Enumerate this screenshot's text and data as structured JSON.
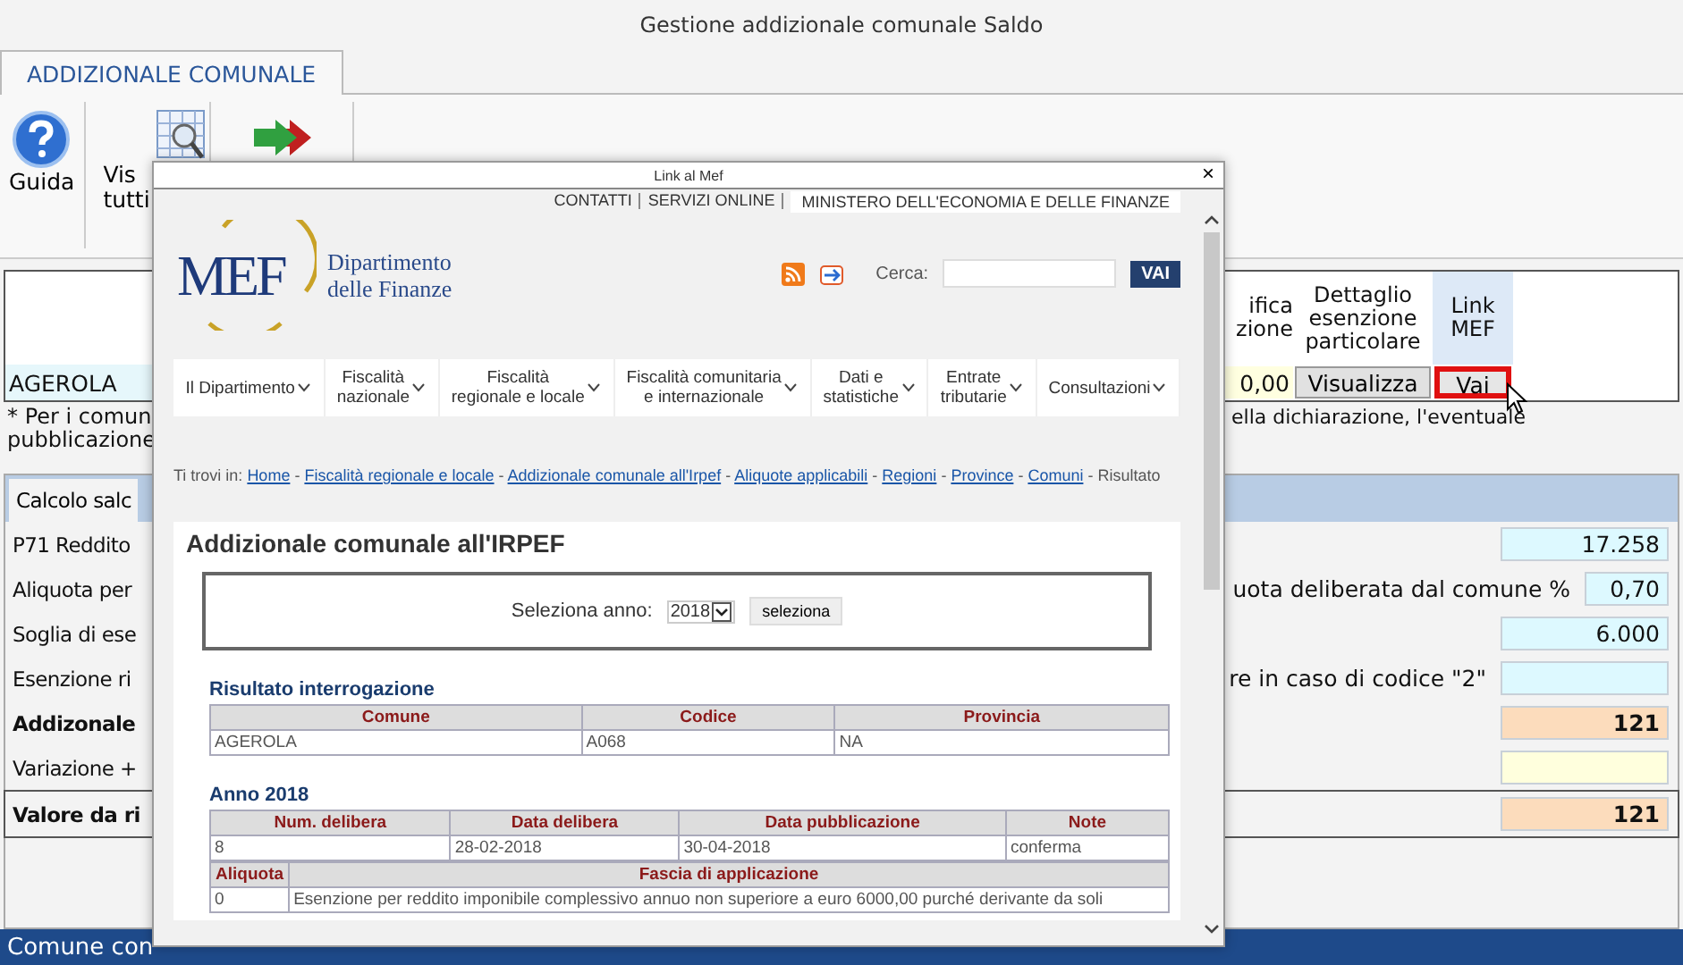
{
  "window": {
    "title": "Gestione addizionale comunale Saldo"
  },
  "ribbon": {
    "tabs": [
      {
        "label": "ADDIZIONALE COMUNALE",
        "selected": true
      }
    ],
    "buttons": [
      {
        "kind": "help",
        "lines": [
          "Guida"
        ]
      },
      {
        "kind": "grid",
        "lines": [
          "Vis",
          "tutti"
        ]
      },
      {
        "kind": "arrow"
      }
    ]
  },
  "grid": {
    "columns": [
      {
        "lines": [
          "ifica",
          "zione"
        ],
        "highlighted": false
      },
      {
        "lines": [
          "Dettaglio",
          "esenzione",
          "particolare"
        ],
        "highlighted": false
      },
      {
        "lines": [
          "Link",
          "MEF"
        ],
        "highlighted": true
      }
    ],
    "row": {
      "comune": "AGEROLA",
      "cells": [
        {
          "kind": "value",
          "text": "0,00"
        },
        {
          "kind": "button",
          "text": "Visualizza",
          "focused": false
        },
        {
          "kind": "button",
          "text": "Vai",
          "focused": true
        }
      ]
    }
  },
  "note": {
    "left": [
      "* Per i comun",
      "pubblicazione"
    ],
    "right": "ella dichiarazione, l'eventuale"
  },
  "calc": {
    "tab": {
      "label": "Calcolo salc",
      "selected": true
    },
    "rows": [
      {
        "label": "P71 Reddito",
        "right_label": "",
        "value": "17.258",
        "color": "#ddf9ff",
        "bold": false,
        "framed": false,
        "narrow": false
      },
      {
        "label": "Aliquota per",
        "right_label": "uota deliberata dal comune %",
        "value": "0,70",
        "color": "#ddf9ff",
        "bold": false,
        "framed": false,
        "narrow": true
      },
      {
        "label": "Soglia di ese",
        "right_label": "",
        "value": "6.000",
        "color": "#ddf9ff",
        "bold": false,
        "framed": false,
        "narrow": false
      },
      {
        "label": "Esenzione ri",
        "right_label": "re in caso di codice \"2\"",
        "value": "",
        "color": "#ddf9ff",
        "bold": false,
        "framed": false,
        "narrow": false
      },
      {
        "label": "Addizonale",
        "right_label": "",
        "value": "121",
        "color": "#fcdcbc",
        "bold": true,
        "framed": false,
        "narrow": false
      },
      {
        "label": "Variazione +",
        "right_label": "",
        "value": "",
        "color": "#ffffdd",
        "bold": false,
        "framed": false,
        "narrow": false
      },
      {
        "label": "Valore da ri",
        "right_label": "",
        "value": "121",
        "color": "#fcdcbc",
        "bold": true,
        "framed": true,
        "narrow": false
      }
    ]
  },
  "status_bar": {
    "text": "Comune con"
  },
  "popup": {
    "title": "Link al Mef",
    "close": "×",
    "top_links": [
      "CONTATTI",
      "SERVIZI ONLINE"
    ],
    "ministry": "MINISTERO DELL'ECONOMIA E DELLE FINANZE",
    "logo": "MEF",
    "dept": [
      "Dipartimento",
      "delle Finanze"
    ],
    "search_label": "Cerca:",
    "search_button": "VAI",
    "nav": [
      {
        "lines": [
          "Il Dipartimento"
        ]
      },
      {
        "lines": [
          "Fiscalità",
          "nazionale"
        ]
      },
      {
        "lines": [
          "Fiscalità",
          "regionale e locale"
        ]
      },
      {
        "lines": [
          "Fiscalità comunitaria",
          "e internazionale"
        ]
      },
      {
        "lines": [
          "Dati e",
          "statistiche"
        ]
      },
      {
        "lines": [
          "Entrate",
          "tributarie"
        ]
      },
      {
        "lines": [
          "Consultazioni"
        ]
      }
    ],
    "breadcrumb_label": "Ti trovi in:",
    "breadcrumb_separator": " - ",
    "breadcrumb": [
      "Home",
      "Fiscalità regionale e locale",
      "Addizionale comunale all'Irpef",
      "Aliquote applicabili",
      "Regioni",
      "Province",
      "Comuni"
    ],
    "breadcrumb_current": "Risultato",
    "heading": "Addizionale comunale all'IRPEF",
    "year_label": "Seleziona anno:",
    "year": "2018",
    "year_button": "seleziona",
    "result_title": "Risultato interrogazione",
    "result_table": {
      "columns": [
        "Comune",
        "Codice",
        "Provincia"
      ],
      "rows": [
        [
          "AGEROLA",
          "A068",
          "NA"
        ]
      ]
    },
    "year_title": "Anno 2018",
    "delibere_table": {
      "columns": [
        "Num. delibera",
        "Data delibera",
        "Data pubblicazione",
        "Note"
      ],
      "rows": [
        [
          "8",
          "28-02-2018",
          "30-04-2018",
          "conferma"
        ]
      ]
    },
    "rates_table": {
      "columns": [
        "Aliquota",
        "Fascia di applicazione"
      ],
      "rows": [
        [
          "0",
          "Esenzione per reddito imponibile complessivo annuo non superiore a euro 6000,00 purché derivante da soli"
        ]
      ]
    }
  }
}
